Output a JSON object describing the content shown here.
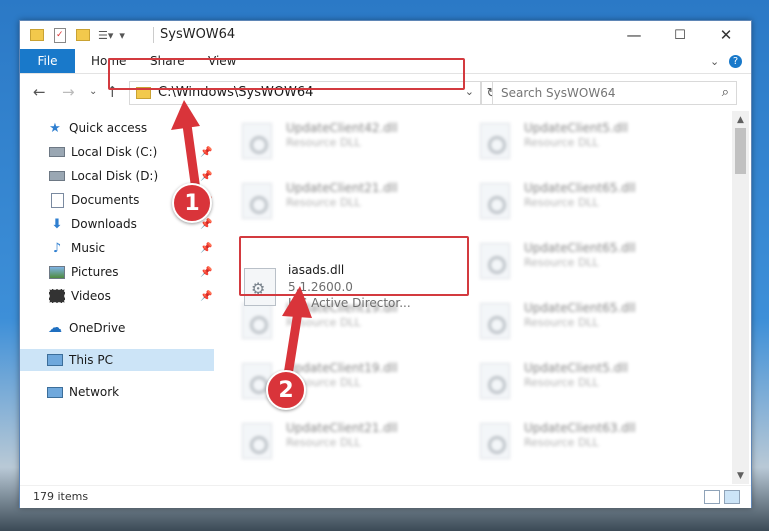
{
  "window": {
    "title": "SysWOW64"
  },
  "window_controls": {
    "minimize": "—",
    "maximize": "☐",
    "close": "✕"
  },
  "ribbon": {
    "file": "File",
    "home": "Home",
    "share": "Share",
    "view": "View"
  },
  "address": {
    "path": "C:\\Windows\\SysWOW64"
  },
  "search": {
    "placeholder": "Search SysWOW64"
  },
  "nav": {
    "quick_access": "Quick access",
    "items": [
      {
        "label": "Local Disk (C:)",
        "icon": "drive-icon"
      },
      {
        "label": "Local Disk (D:)",
        "icon": "drive-icon"
      },
      {
        "label": "Documents",
        "icon": "documents-icon"
      },
      {
        "label": "Downloads",
        "icon": "download-icon"
      },
      {
        "label": "Music",
        "icon": "music-icon"
      },
      {
        "label": "Pictures",
        "icon": "pictures-icon"
      },
      {
        "label": "Videos",
        "icon": "videos-icon"
      }
    ],
    "onedrive": "OneDrive",
    "this_pc": "This PC",
    "network": "Network"
  },
  "files": {
    "left": [
      {
        "name": "UpdateClient42.dll",
        "desc": "Resource DLL"
      },
      {
        "name": "UpdateClient21.dll",
        "desc": "Resource DLL"
      },
      {
        "name": "UpdateClient19.dll",
        "desc": "Resource DLL"
      },
      {
        "name": "UpdateClient19.dll",
        "desc": "Resource DLL"
      },
      {
        "name": "UpdateClient21.dll",
        "desc": "Resource DLL"
      }
    ],
    "right": [
      {
        "name": "UpdateClient5.dll",
        "desc": "Resource DLL"
      },
      {
        "name": "UpdateClient65.dll",
        "desc": "Resource DLL"
      },
      {
        "name": "UpdateClient65.dll",
        "desc": "Resource DLL"
      },
      {
        "name": "UpdateClient65.dll",
        "desc": "Resource DLL"
      },
      {
        "name": "UpdateClient5.dll",
        "desc": "Resource DLL"
      },
      {
        "name": "UpdateClient63.dll",
        "desc": "Resource DLL"
      }
    ],
    "selected": {
      "name": "iasads.dll",
      "version": "5.1.2600.0",
      "desc": "IAS Active Director..."
    }
  },
  "status": {
    "count": "179 items"
  },
  "callouts": {
    "one": "1",
    "two": "2"
  },
  "colors": {
    "accent": "#1979ca",
    "highlight": "#d33a3f"
  }
}
